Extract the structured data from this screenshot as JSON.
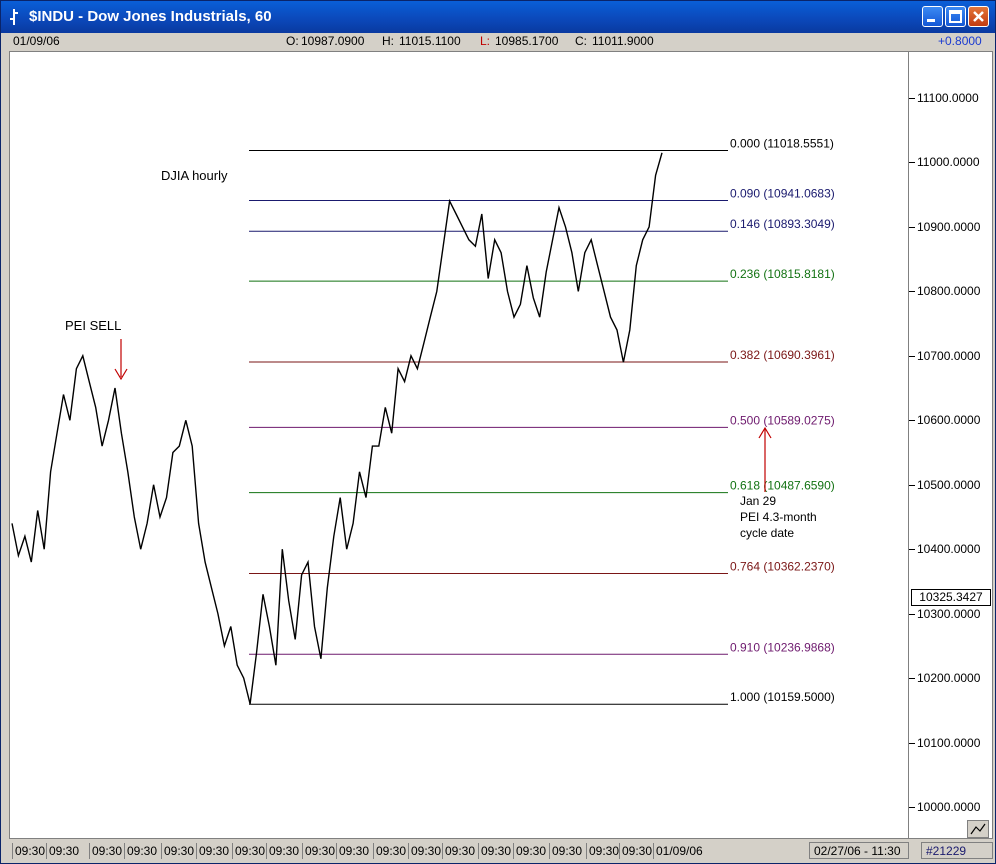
{
  "window": {
    "title": "$INDU - Dow Jones Industrials, 60",
    "icon": "chart-app-icon",
    "buttons": [
      "minimize",
      "maximize",
      "close"
    ]
  },
  "infobar": {
    "date": "01/09/06",
    "open_label": "O:",
    "open": "10987.0900",
    "high_label": "H:",
    "high": "11015.1100",
    "low_label": "L:",
    "low": "10985.1700",
    "close_label": "C:",
    "close": "11011.9000",
    "change": "+0.8000"
  },
  "statusbar": {
    "time_labels": [
      "09:30",
      "09:30",
      "09:30",
      "09:30",
      "09:30",
      "09:30",
      "09:30",
      "09:30",
      "09:30",
      "09:30",
      "09:30",
      "09:30",
      "09:30",
      "09:30",
      "09:30",
      "09:30",
      "09:30",
      "09:30",
      "01/09/06"
    ],
    "cursor": "02/27/06 - 11:30",
    "count": "#21229"
  },
  "chart_data": {
    "type": "line",
    "annotations": {
      "title": "DJIA hourly",
      "sell": "PEI SELL",
      "cycle_note": [
        "Jan 29",
        "PEI 4.3-month",
        "cycle date"
      ]
    },
    "y_axis": {
      "ticks": [
        "11100.0000",
        "11000.0000",
        "10900.0000",
        "10800.0000",
        "10700.0000",
        "10600.0000",
        "10500.0000",
        "10400.0000",
        "10300.0000",
        "10200.0000",
        "10100.0000",
        "10000.0000"
      ],
      "last_value": "10325.3427",
      "range": [
        9970,
        11160
      ]
    },
    "fib_levels": [
      {
        "label": "0.000 (11018.5551)",
        "value": 11018.5551,
        "color": "#000000"
      },
      {
        "label": "0.090 (10941.0683)",
        "value": 10941.0683,
        "color": "#1a1a6e"
      },
      {
        "label": "0.146 (10893.3049)",
        "value": 10893.3049,
        "color": "#1a1a6e"
      },
      {
        "label": "0.236 (10815.8181)",
        "value": 10815.8181,
        "color": "#127212"
      },
      {
        "label": "0.382 (10690.3961)",
        "value": 10690.3961,
        "color": "#7a1616"
      },
      {
        "label": "0.500 (10589.0275)",
        "value": 10589.0275,
        "color": "#6e1a6e"
      },
      {
        "label": "0.618 (10487.6590)",
        "value": 10487.659,
        "color": "#127212"
      },
      {
        "label": "0.764 (10362.2370)",
        "value": 10362.237,
        "color": "#7a1616"
      },
      {
        "label": "0.910 (10236.9868)",
        "value": 10236.9868,
        "color": "#6e1a6e"
      },
      {
        "label": "1.000 (10159.5000)",
        "value": 10159.5,
        "color": "#000000"
      }
    ],
    "series": [
      {
        "values": [
          10440,
          10390,
          10420,
          10380,
          10460,
          10400,
          10520,
          10580,
          10640,
          10600,
          10680,
          10700,
          10660,
          10620,
          10560,
          10600,
          10650,
          10580,
          10520,
          10450,
          10400,
          10440,
          10500,
          10450,
          10480,
          10550,
          10560,
          10600,
          10560,
          10440,
          10380,
          10340,
          10300,
          10250,
          10280,
          10220,
          10200,
          10160,
          10240,
          10330,
          10280,
          10220,
          10400,
          10320,
          10260,
          10360,
          10380,
          10280,
          10230,
          10340,
          10420,
          10480,
          10400,
          10440,
          10520,
          10480,
          10560,
          10560,
          10620,
          10580,
          10680,
          10660,
          10700,
          10680,
          10720,
          10760,
          10800,
          10870,
          10940,
          10920,
          10900,
          10880,
          10870,
          10920,
          10820,
          10880,
          10860,
          10800,
          10760,
          10780,
          10840,
          10790,
          10760,
          10830,
          10880,
          10930,
          10900,
          10860,
          10800,
          10860,
          10880,
          10840,
          10800,
          10760,
          10740,
          10690,
          10740,
          10840,
          10880,
          10900,
          10980,
          11015
        ]
      }
    ]
  }
}
